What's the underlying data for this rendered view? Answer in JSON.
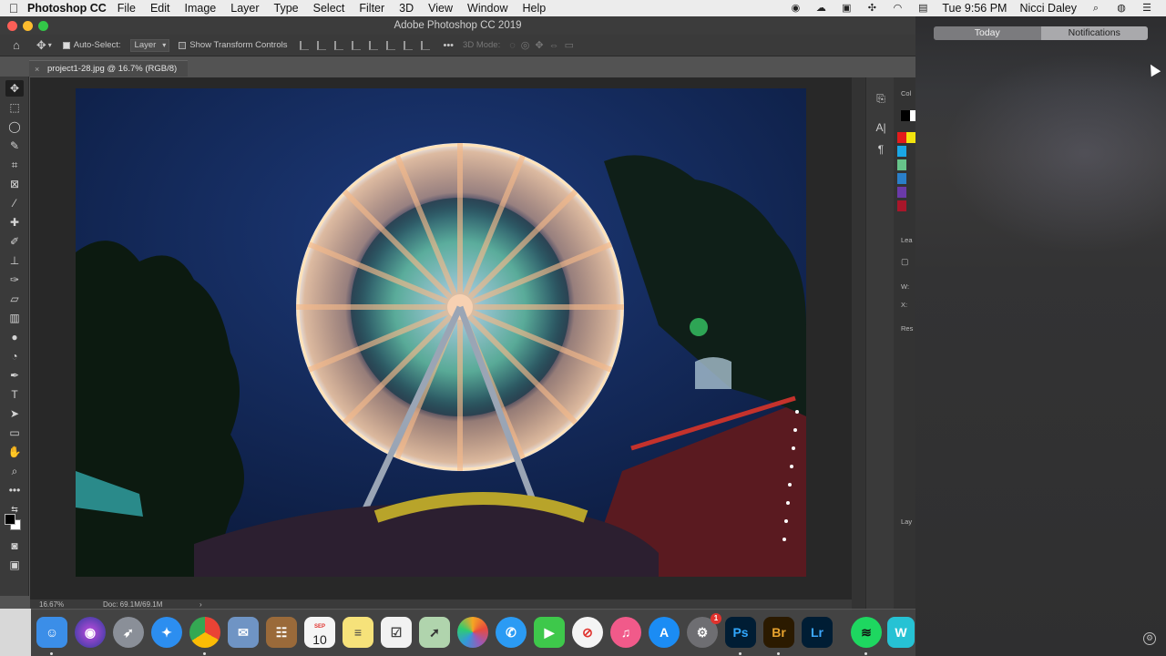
{
  "menubar": {
    "app_name": "Photoshop CC",
    "items": [
      "File",
      "Edit",
      "Image",
      "Layer",
      "Type",
      "Select",
      "Filter",
      "3D",
      "View",
      "Window",
      "Help"
    ],
    "clock": "Tue 9:56 PM",
    "user": "Nicci Daley"
  },
  "window": {
    "title": "Adobe Photoshop CC 2019"
  },
  "options_bar": {
    "auto_select_label": "Auto-Select:",
    "auto_select_value": "Layer",
    "show_transform_label": "Show Transform Controls",
    "mode_3d_label": "3D Mode:"
  },
  "document": {
    "tab_title": "project1-28.jpg @ 16.7% (RGB/8)"
  },
  "statusbar": {
    "zoom": "16.67%",
    "doc_size": "Doc: 69.1M/69.1M"
  },
  "right_panel": {
    "color_label": "Col",
    "learn_label": "Lea",
    "w_label": "W:",
    "x_label": "X:",
    "reset_label": "Res",
    "layers_label": "Lay"
  },
  "notification_center": {
    "tab_today": "Today",
    "tab_notifications": "Notifications"
  },
  "dock": {
    "calendar_month": "SEP",
    "calendar_day": "10",
    "app_store_badge": "1",
    "ps_label": "Ps",
    "br_label": "Br",
    "lr_label": "Lr"
  },
  "colors": {
    "accent_ps": "#31a8ff",
    "accent_br": "#e8a32e",
    "accent_lr": "#3ca8ff"
  }
}
